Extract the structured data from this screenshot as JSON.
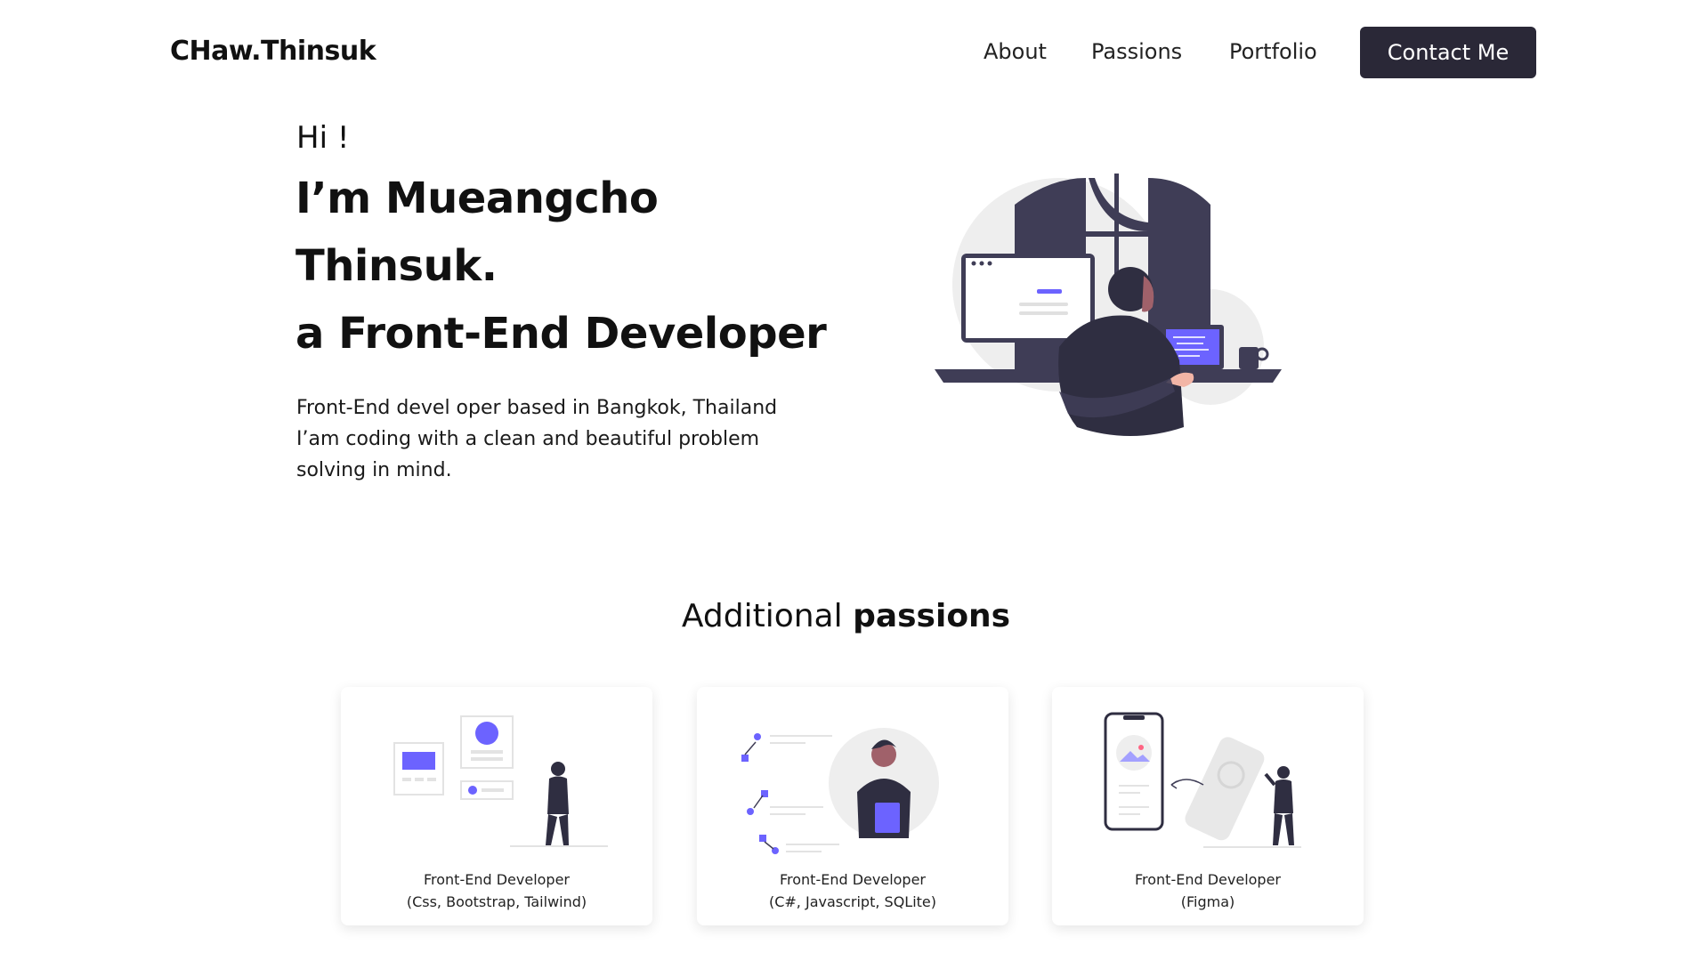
{
  "nav": {
    "brand": "CHaw.Thinsuk",
    "links": [
      "About",
      "Passions",
      "Portfolio"
    ],
    "contact_label": "Contact Me"
  },
  "hero": {
    "greeting": "Hi !",
    "title_lines": [
      "I’m Mueangcho",
      "Thinsuk.",
      "a Front-End Developer"
    ],
    "description_lines": [
      "Front-End devel oper based in Bangkok, Thailand",
      "I’am coding with a clean and beautiful problem",
      "solving in mind."
    ]
  },
  "passions": {
    "title_light": "Additional",
    "title_bold": "passions",
    "cards": [
      {
        "line1": "Front-End Developer",
        "line2": "(Css, Bootstrap, Tailwind)",
        "icon": "web-layout-illustration"
      },
      {
        "line1": "Front-End Developer",
        "line2": "(C#, Javascript, SQLite)",
        "icon": "developer-steps-illustration"
      },
      {
        "line1": "Front-End Developer",
        "line2": "(Figma)",
        "icon": "mobile-design-illustration"
      }
    ]
  },
  "colors": {
    "accent": "#6c63ff",
    "dark": "#2f2e41",
    "button_bg": "#2a2837"
  }
}
